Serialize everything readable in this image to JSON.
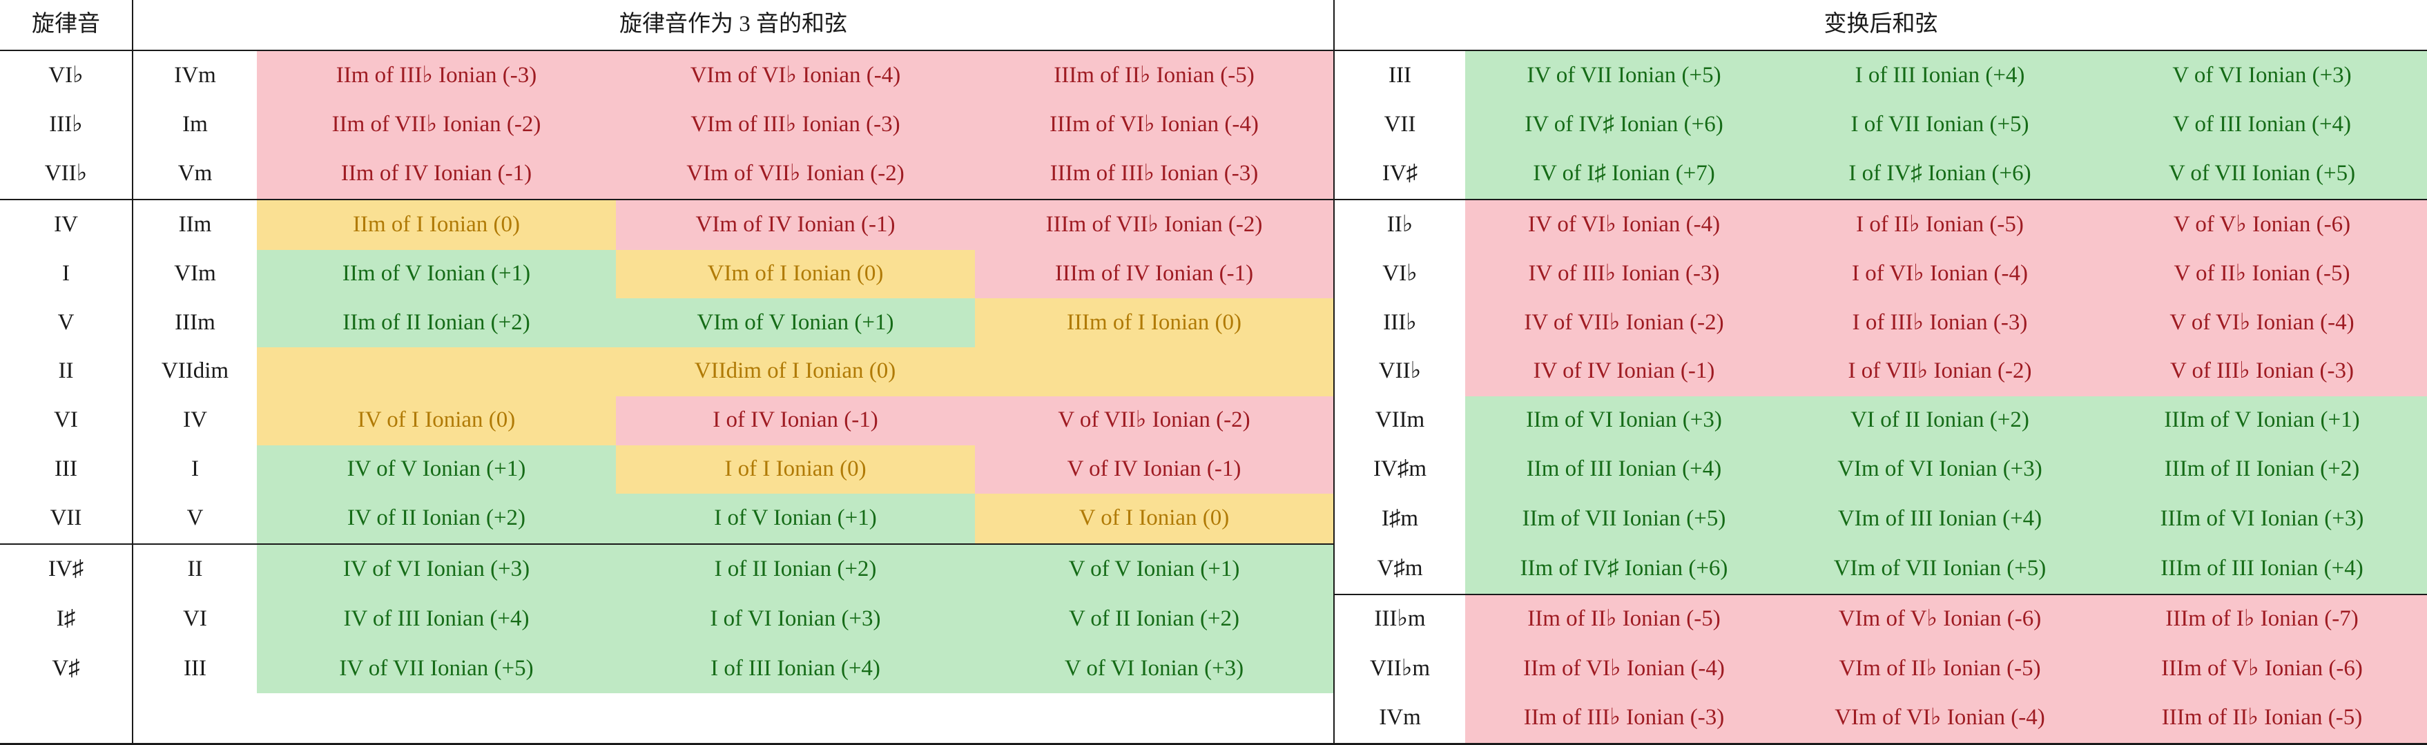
{
  "headers": {
    "melody_tone": "旋律音",
    "chord_blank": "",
    "left_group": "旋律音作为 3 音的和弦",
    "right_group": "变换后和弦"
  },
  "colors": {
    "pink_bg": "#f9c5cb",
    "pink_fg": "#9e1b22",
    "green_bg": "#bfe9c4",
    "green_fg": "#156b17",
    "yellow_bg": "#fae093",
    "yellow_fg": "#b07a06",
    "rule": "#1a1a1a"
  },
  "left_table": {
    "sections": [
      {
        "rows": [
          {
            "melody": "VI♭",
            "chord": "IVm",
            "cells": [
              {
                "text": "IIm of III♭ Ionian (-3)",
                "fill": "pink"
              },
              {
                "text": "VIm of VI♭ Ionian (-4)",
                "fill": "pink"
              },
              {
                "text": "IIIm of II♭ Ionian (-5)",
                "fill": "pink"
              }
            ]
          },
          {
            "melody": "III♭",
            "chord": "Im",
            "cells": [
              {
                "text": "IIm of VII♭ Ionian (-2)",
                "fill": "pink"
              },
              {
                "text": "VIm of III♭ Ionian (-3)",
                "fill": "pink"
              },
              {
                "text": "IIIm of VI♭ Ionian (-4)",
                "fill": "pink"
              }
            ]
          },
          {
            "melody": "VII♭",
            "chord": "Vm",
            "cells": [
              {
                "text": "IIm of IV Ionian (-1)",
                "fill": "pink"
              },
              {
                "text": "VIm of VII♭ Ionian (-2)",
                "fill": "pink"
              },
              {
                "text": "IIIm of III♭ Ionian (-3)",
                "fill": "pink"
              }
            ]
          }
        ]
      },
      {
        "rows": [
          {
            "melody": "IV",
            "chord": "IIm",
            "cells": [
              {
                "text": "IIm of I Ionian (0)",
                "fill": "yellow"
              },
              {
                "text": "VIm of IV Ionian (-1)",
                "fill": "pink"
              },
              {
                "text": "IIIm of VII♭ Ionian (-2)",
                "fill": "pink"
              }
            ]
          },
          {
            "melody": "I",
            "chord": "VIm",
            "cells": [
              {
                "text": "IIm of V Ionian (+1)",
                "fill": "green"
              },
              {
                "text": "VIm of I Ionian (0)",
                "fill": "yellow"
              },
              {
                "text": "IIIm of IV Ionian (-1)",
                "fill": "pink"
              }
            ]
          },
          {
            "melody": "V",
            "chord": "IIIm",
            "cells": [
              {
                "text": "IIm of II Ionian (+2)",
                "fill": "green"
              },
              {
                "text": "VIm of V Ionian (+1)",
                "fill": "green"
              },
              {
                "text": "IIIm of I Ionian (0)",
                "fill": "yellow"
              }
            ]
          },
          {
            "melody": "II",
            "chord": "VIIdim",
            "merged": true,
            "cells": [
              {
                "text": "VIIdim of I Ionian (0)",
                "fill": "yellow",
                "span": 3
              }
            ]
          },
          {
            "melody": "VI",
            "chord": "IV",
            "cells": [
              {
                "text": "IV of I Ionian (0)",
                "fill": "yellow"
              },
              {
                "text": "I of IV Ionian (-1)",
                "fill": "pink"
              },
              {
                "text": "V of VII♭ Ionian (-2)",
                "fill": "pink"
              }
            ]
          },
          {
            "melody": "III",
            "chord": "I",
            "cells": [
              {
                "text": "IV of V Ionian (+1)",
                "fill": "green"
              },
              {
                "text": "I of I Ionian (0)",
                "fill": "yellow"
              },
              {
                "text": "V of IV Ionian (-1)",
                "fill": "pink"
              }
            ]
          },
          {
            "melody": "VII",
            "chord": "V",
            "cells": [
              {
                "text": "IV of II Ionian (+2)",
                "fill": "green"
              },
              {
                "text": "I of V Ionian (+1)",
                "fill": "green"
              },
              {
                "text": "V of I Ionian (0)",
                "fill": "yellow"
              }
            ]
          }
        ]
      },
      {
        "rows": [
          {
            "melody": "IV♯",
            "chord": "II",
            "cells": [
              {
                "text": "IV of VI Ionian (+3)",
                "fill": "green"
              },
              {
                "text": "I of II Ionian (+2)",
                "fill": "green"
              },
              {
                "text": "V of V Ionian (+1)",
                "fill": "green"
              }
            ]
          },
          {
            "melody": "I♯",
            "chord": "VI",
            "cells": [
              {
                "text": "IV of III Ionian (+4)",
                "fill": "green"
              },
              {
                "text": "I of VI Ionian (+3)",
                "fill": "green"
              },
              {
                "text": "V of II Ionian (+2)",
                "fill": "green"
              }
            ]
          },
          {
            "melody": "V♯",
            "chord": "III",
            "cells": [
              {
                "text": "IV of VII Ionian (+5)",
                "fill": "green"
              },
              {
                "text": "I of III Ionian (+4)",
                "fill": "green"
              },
              {
                "text": "V of VI Ionian (+3)",
                "fill": "green"
              }
            ]
          }
        ]
      }
    ]
  },
  "right_table": {
    "sections": [
      {
        "rows": [
          {
            "label": "III",
            "cells": [
              {
                "text": "IV of VII Ionian (+5)",
                "fill": "green"
              },
              {
                "text": "I of III Ionian (+4)",
                "fill": "green"
              },
              {
                "text": "V of VI Ionian (+3)",
                "fill": "green"
              }
            ]
          },
          {
            "label": "VII",
            "cells": [
              {
                "text": "IV of IV♯ Ionian (+6)",
                "fill": "green"
              },
              {
                "text": "I of VII Ionian (+5)",
                "fill": "green"
              },
              {
                "text": "V of III Ionian (+4)",
                "fill": "green"
              }
            ]
          },
          {
            "label": "IV♯",
            "cells": [
              {
                "text": "IV of I♯ Ionian (+7)",
                "fill": "green"
              },
              {
                "text": "I of IV♯ Ionian (+6)",
                "fill": "green"
              },
              {
                "text": "V of VII Ionian (+5)",
                "fill": "green"
              }
            ]
          }
        ]
      },
      {
        "rows": [
          {
            "label": "II♭",
            "cells": [
              {
                "text": "IV of VI♭ Ionian (-4)",
                "fill": "pink"
              },
              {
                "text": "I of II♭ Ionian (-5)",
                "fill": "pink"
              },
              {
                "text": "V of V♭ Ionian (-6)",
                "fill": "pink"
              }
            ]
          },
          {
            "label": "VI♭",
            "cells": [
              {
                "text": "IV of III♭ Ionian (-3)",
                "fill": "pink"
              },
              {
                "text": "I of VI♭ Ionian (-4)",
                "fill": "pink"
              },
              {
                "text": "V of II♭ Ionian (-5)",
                "fill": "pink"
              }
            ]
          },
          {
            "label": "III♭",
            "cells": [
              {
                "text": "IV of VII♭ Ionian (-2)",
                "fill": "pink"
              },
              {
                "text": "I of III♭ Ionian (-3)",
                "fill": "pink"
              },
              {
                "text": "V of VI♭ Ionian (-4)",
                "fill": "pink"
              }
            ]
          },
          {
            "label": "VII♭",
            "cells": [
              {
                "text": "IV of IV Ionian (-1)",
                "fill": "pink"
              },
              {
                "text": "I of VII♭ Ionian (-2)",
                "fill": "pink"
              },
              {
                "text": "V of III♭ Ionian (-3)",
                "fill": "pink"
              }
            ]
          },
          {
            "label": "VIIm",
            "cells": [
              {
                "text": "IIm of VI Ionian (+3)",
                "fill": "green"
              },
              {
                "text": "VI of II Ionian (+2)",
                "fill": "green"
              },
              {
                "text": "IIIm of V Ionian (+1)",
                "fill": "green"
              }
            ]
          },
          {
            "label": "IV♯m",
            "cells": [
              {
                "text": "IIm of III Ionian (+4)",
                "fill": "green"
              },
              {
                "text": "VIm of VI Ionian (+3)",
                "fill": "green"
              },
              {
                "text": "IIIm of II Ionian (+2)",
                "fill": "green"
              }
            ]
          },
          {
            "label": "I♯m",
            "cells": [
              {
                "text": "IIm of VII Ionian (+5)",
                "fill": "green"
              },
              {
                "text": "VIm of III Ionian (+4)",
                "fill": "green"
              },
              {
                "text": "IIIm of VI Ionian (+3)",
                "fill": "green"
              }
            ]
          },
          {
            "label": "V♯m",
            "cells": [
              {
                "text": "IIm of IV♯ Ionian (+6)",
                "fill": "green"
              },
              {
                "text": "VIm of VII Ionian (+5)",
                "fill": "green"
              },
              {
                "text": "IIIm of III Ionian (+4)",
                "fill": "green"
              }
            ]
          }
        ]
      },
      {
        "rows": [
          {
            "label": "III♭m",
            "cells": [
              {
                "text": "IIm of II♭ Ionian (-5)",
                "fill": "pink"
              },
              {
                "text": "VIm of V♭ Ionian (-6)",
                "fill": "pink"
              },
              {
                "text": "IIIm of I♭ Ionian (-7)",
                "fill": "pink"
              }
            ]
          },
          {
            "label": "VII♭m",
            "cells": [
              {
                "text": "IIm of VI♭ Ionian (-4)",
                "fill": "pink"
              },
              {
                "text": "VIm of II♭ Ionian (-5)",
                "fill": "pink"
              },
              {
                "text": "IIIm of V♭ Ionian (-6)",
                "fill": "pink"
              }
            ]
          },
          {
            "label": "IVm",
            "cells": [
              {
                "text": "IIm of III♭ Ionian (-3)",
                "fill": "pink"
              },
              {
                "text": "VIm of VI♭ Ionian (-4)",
                "fill": "pink"
              },
              {
                "text": "IIIm of II♭ Ionian (-5)",
                "fill": "pink"
              }
            ]
          }
        ]
      }
    ]
  }
}
